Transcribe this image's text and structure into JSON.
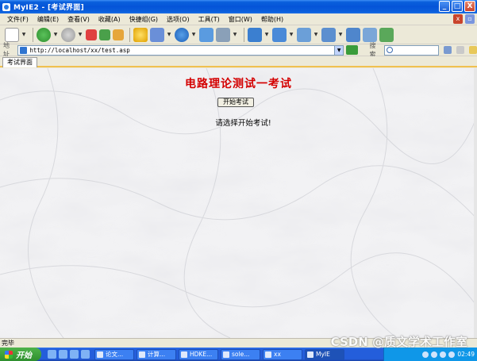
{
  "window": {
    "title": "MyIE2 - [考试界面]",
    "buttons": {
      "minimize": "_",
      "maximize": "□",
      "close": "X"
    }
  },
  "menu": {
    "items": [
      "文件(F)",
      "编辑(E)",
      "查看(V)",
      "收藏(A)",
      "快捷组(G)",
      "选项(O)",
      "工具(T)",
      "窗口(W)",
      "帮助(H)"
    ]
  },
  "address": {
    "label": "地址",
    "url": "http://localhost/xx/test.asp"
  },
  "search": {
    "label": "搜索",
    "value": ""
  },
  "tab": {
    "label": "考试界面"
  },
  "page": {
    "title": "电路理论测试一考试",
    "start_button": "开始考试",
    "prompt": "请选择开始考试!"
  },
  "status": {
    "text": "完毕"
  },
  "taskbar": {
    "start": "开始",
    "tasks": [
      "论文...",
      "计算...",
      "HDKE...",
      "sole...",
      "xx",
      "MyIE"
    ],
    "clock": "02:49"
  },
  "watermark": "CSDN @质文学术工作室",
  "colors": {
    "title_red": "#d40000",
    "titlebar_blue": "#0554d8",
    "tab_accent": "#f0c050"
  }
}
